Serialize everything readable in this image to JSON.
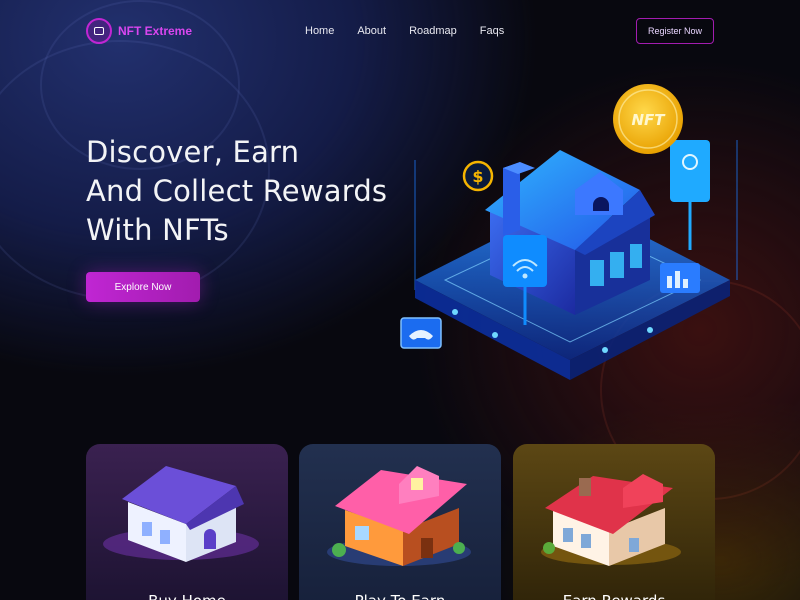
{
  "brand": {
    "name": "NFT Extreme"
  },
  "nav": {
    "links": [
      "Home",
      "About",
      "Roadmap",
      "Faqs"
    ],
    "register_label": "Register Now"
  },
  "hero": {
    "title_lines": [
      "Discover, Earn",
      "And Collect Rewards",
      "With NFTs"
    ],
    "cta_label": "Explore Now",
    "coin_label": "NFT",
    "dollar_symbol": "$"
  },
  "cards": [
    {
      "title": "Buy Home",
      "color": "#3a2150"
    },
    {
      "title": "Play To Earn",
      "color": "#22304f"
    },
    {
      "title": "Earn Rewards",
      "color": "#5c4714"
    }
  ],
  "colors": {
    "accent": "#c026d3",
    "brand_text": "#d946ef",
    "coin": "#f5b400",
    "illustration_blue": "#1e90ff"
  }
}
